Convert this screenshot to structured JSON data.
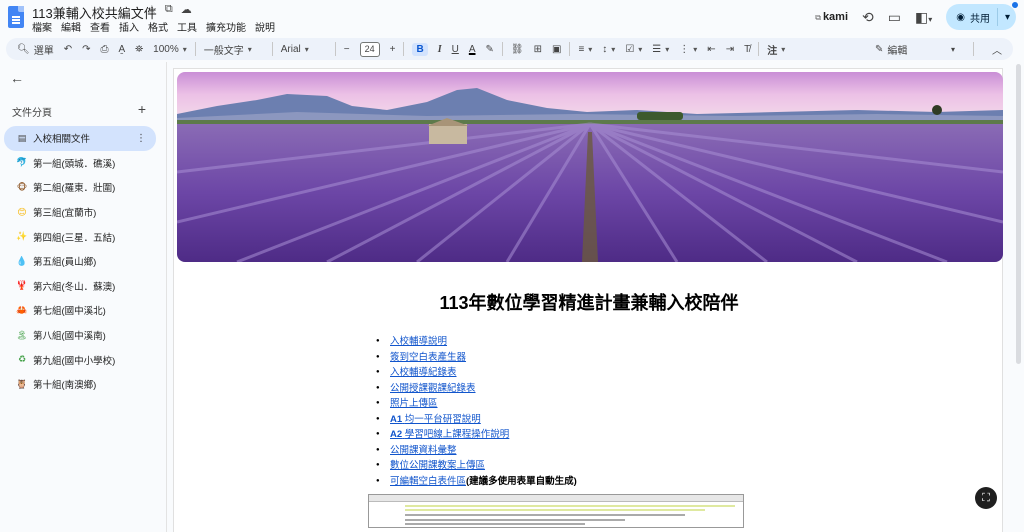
{
  "app": {
    "title": "113兼輔入校共編文件",
    "title_icons": [
      "star-icon",
      "folder-move-icon",
      "cloud-status-icon"
    ]
  },
  "menu": [
    "檔案",
    "編輯",
    "查看",
    "插入",
    "格式",
    "工具",
    "擴充功能",
    "說明"
  ],
  "header_right": {
    "kami_label": "kami",
    "share_label": "共用"
  },
  "toolbar": {
    "search_label": "選單",
    "zoom": "100%",
    "style": "一般文字",
    "font": "Arial",
    "font_size": "24",
    "bold": "B",
    "italic": "I",
    "underline": "U",
    "text_color": "A",
    "notes_label": "注",
    "editing_mode": "編輯"
  },
  "sidebar": {
    "section_title": "文件分頁",
    "items": [
      {
        "label": "入校相關文件",
        "icon": "doc-icon",
        "glyph": "▤",
        "color": "#444444",
        "active": true
      },
      {
        "label": "第一組(頭城．礁溪)",
        "icon": "dolphin-icon",
        "glyph": "🐬",
        "color": "#1e88e5",
        "active": false
      },
      {
        "label": "第二組(羅東．壯圍)",
        "icon": "monkey-icon",
        "glyph": "🐵",
        "color": "#8d5524",
        "active": false
      },
      {
        "label": "第三組(宜蘭市)",
        "icon": "smile-icon",
        "glyph": "😊",
        "color": "#f6b400",
        "active": false
      },
      {
        "label": "第四組(三星．五結)",
        "icon": "sparkle-icon",
        "glyph": "✨",
        "color": "#f6b400",
        "active": false
      },
      {
        "label": "第五組(員山鄉)",
        "icon": "droplet-icon",
        "glyph": "💧",
        "color": "#29b6f6",
        "active": false
      },
      {
        "label": "第六組(冬山．蘇澳)",
        "icon": "lobster-icon",
        "glyph": "🦞",
        "color": "#e53935",
        "active": false
      },
      {
        "label": "第七組(國中溪北)",
        "icon": "crab-icon",
        "glyph": "🦀",
        "color": "#e53935",
        "active": false
      },
      {
        "label": "第八組(國中溪南)",
        "icon": "palm-island-icon",
        "glyph": "🏝",
        "color": "#43a047",
        "active": false
      },
      {
        "label": "第九組(國中小學校)",
        "icon": "recycle-icon",
        "glyph": "♻",
        "color": "#43a047",
        "active": false
      },
      {
        "label": "第十組(南澳鄉)",
        "icon": "owl-icon",
        "glyph": "🦉",
        "color": "#8d6e63",
        "active": false
      }
    ]
  },
  "document": {
    "headline": "113年數位學習精進計畫兼輔入校陪伴",
    "links": [
      {
        "prefix": "",
        "text": "入校輔導說明",
        "suffix": ""
      },
      {
        "prefix": "",
        "text": "簽到空白表產生器",
        "suffix": ""
      },
      {
        "prefix": "",
        "text": "入校輔導紀錄表",
        "suffix": ""
      },
      {
        "prefix": "",
        "text": "公開授課觀課紀錄表",
        "suffix": ""
      },
      {
        "prefix": "",
        "text": "照片上傳區",
        "suffix": ""
      },
      {
        "prefix": "A1",
        "text": "均一平台研習說明",
        "suffix": ""
      },
      {
        "prefix": "A2",
        "text": "學習吧線上課程操作說明",
        "suffix": ""
      },
      {
        "prefix": "",
        "text": "公開課資料彙整",
        "suffix": ""
      },
      {
        "prefix": "",
        "text": "數位公開課教案上傳區",
        "suffix": ""
      },
      {
        "prefix": "",
        "text": "可編輯空白表件區",
        "suffix": "(建議多使用表單自動生成)"
      }
    ]
  }
}
